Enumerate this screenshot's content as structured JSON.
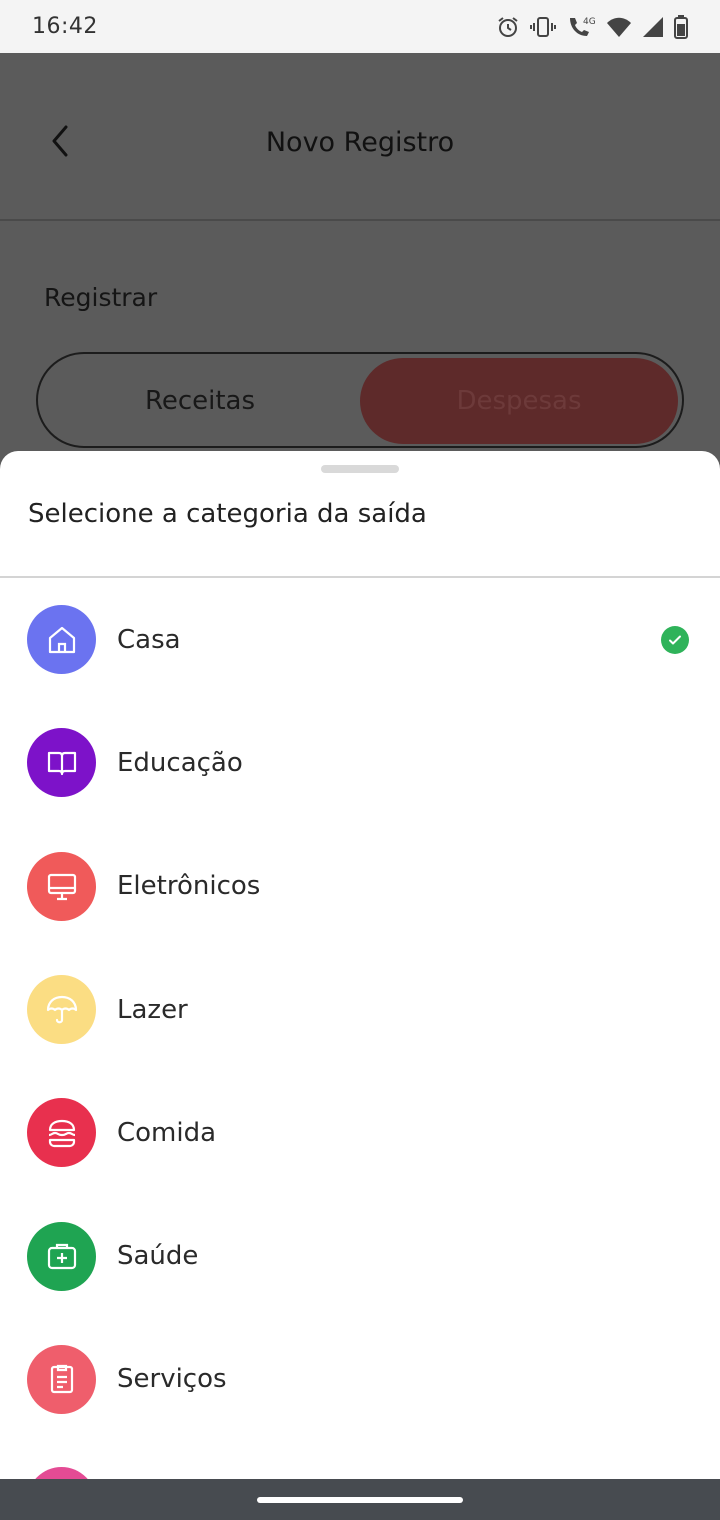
{
  "status_bar": {
    "time": "16:42",
    "network": "4G",
    "icons": [
      "alarm-icon",
      "vibrate-icon",
      "wifi-call-icon",
      "wifi-icon",
      "signal-icon",
      "battery-icon"
    ]
  },
  "appbar": {
    "title": "Novo Registro",
    "back_icon": "chevron-left-icon"
  },
  "form": {
    "section_label": "Registrar",
    "segments": [
      {
        "label": "Receitas",
        "selected": false
      },
      {
        "label": "Despesas",
        "selected": true
      }
    ]
  },
  "sheet": {
    "title": "Selecione a categoria da saída",
    "categories": [
      {
        "label": "Casa",
        "icon": "home-icon",
        "color": "#6b73f0",
        "selected": true
      },
      {
        "label": "Educação",
        "icon": "book-open-icon",
        "color": "#7d12c9",
        "selected": false
      },
      {
        "label": "Eletrônicos",
        "icon": "monitor-icon",
        "color": "#f05a5a",
        "selected": false
      },
      {
        "label": "Lazer",
        "icon": "umbrella-icon",
        "color": "#fbdd83",
        "selected": false
      },
      {
        "label": "Comida",
        "icon": "burger-icon",
        "color": "#e8304e",
        "selected": false
      },
      {
        "label": "Saúde",
        "icon": "medical-kit-icon",
        "color": "#1fa452",
        "selected": false
      },
      {
        "label": "Serviços",
        "icon": "clipboard-icon",
        "color": "#ef5e6c",
        "selected": false
      }
    ],
    "partial_next_color": "#e44b94",
    "selected_check_color": "#2fb35a"
  }
}
